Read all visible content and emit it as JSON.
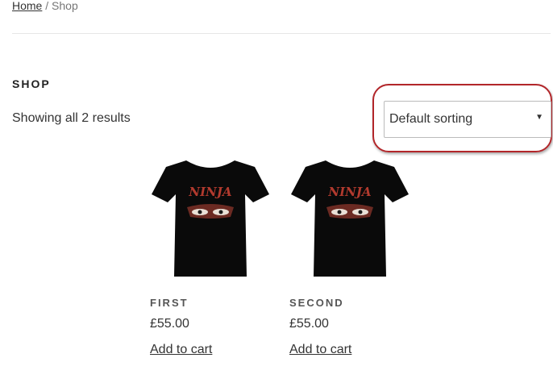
{
  "breadcrumb": {
    "home": "Home",
    "separator": " / ",
    "current": "Shop"
  },
  "page": {
    "title": "SHOP",
    "result_count": "Showing all 2 results"
  },
  "sorting": {
    "selected": "Default sorting",
    "highlight_color": "#b2262a"
  },
  "products": [
    {
      "name": "FIRST",
      "price": "£55.00",
      "cart_label": "Add to cart",
      "shirt_text": "NINJA"
    },
    {
      "name": "SECOND",
      "price": "£55.00",
      "cart_label": "Add to cart",
      "shirt_text": "NINJA"
    }
  ]
}
